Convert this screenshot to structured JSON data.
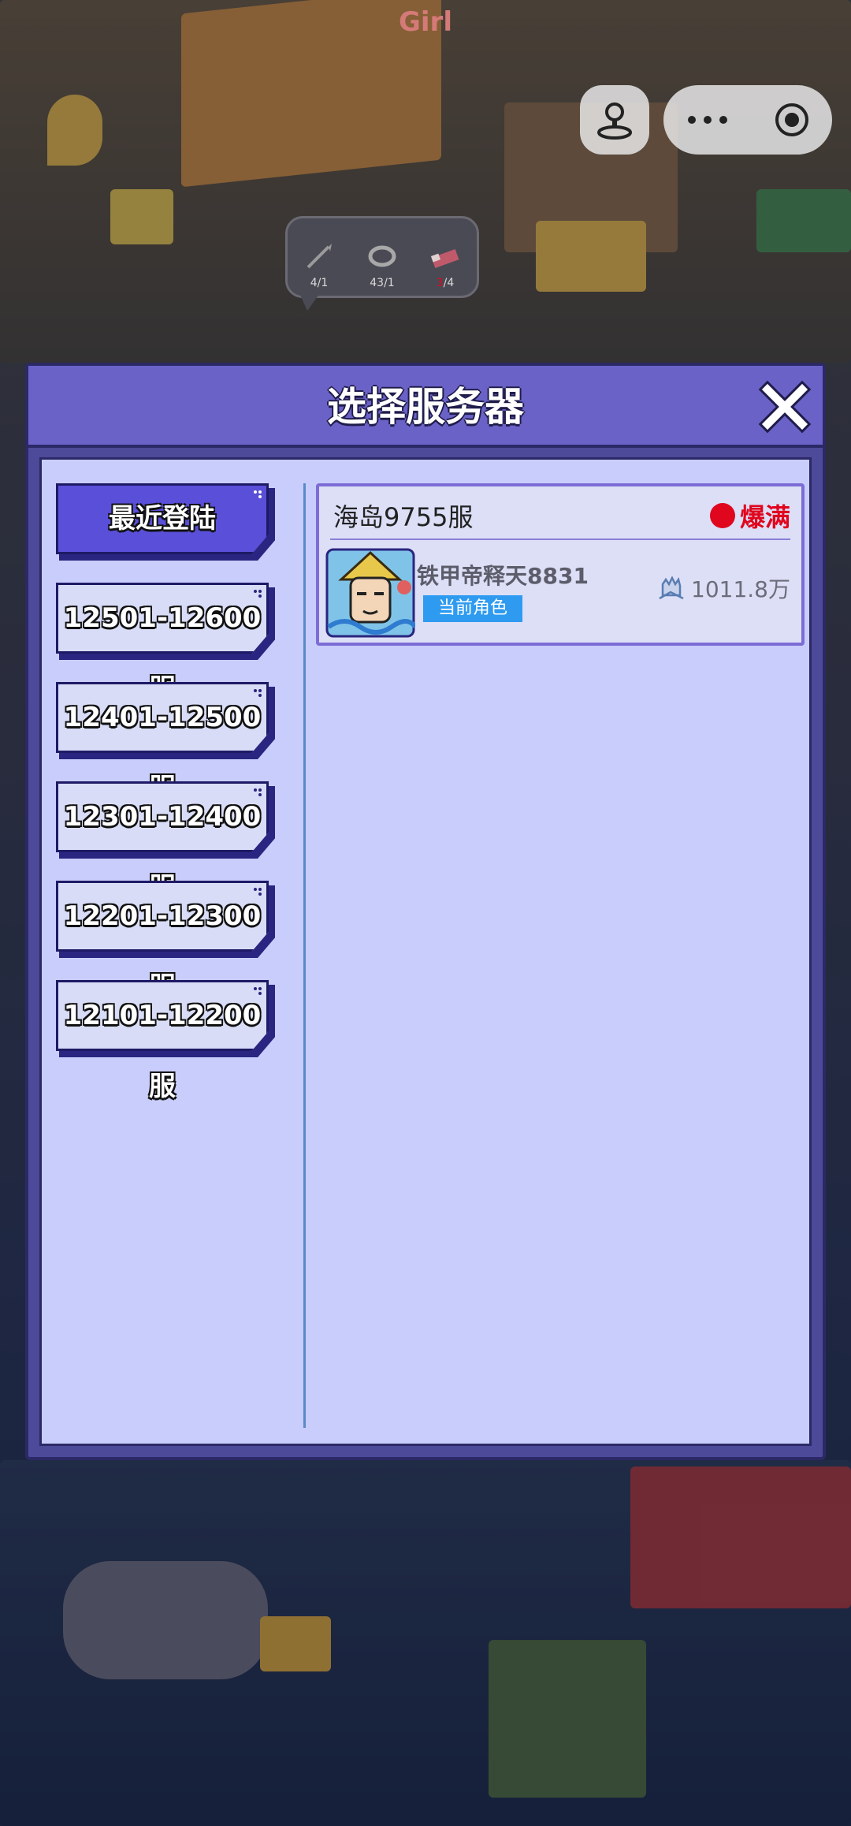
{
  "top_bar": {
    "title": "Girl"
  },
  "inventory": [
    {
      "icon": "harpoon-icon",
      "value": "4/1",
      "color": "#d9d9d9"
    },
    {
      "icon": "rope-ring-icon",
      "value": "43/1",
      "color": "#d9d9d9"
    },
    {
      "icon": "bed-icon",
      "value_main": "3",
      "value_rest": "/4",
      "color_main": "#e0061e"
    }
  ],
  "modal": {
    "title": "选择服务器",
    "categories": [
      {
        "label": "最近登陆",
        "active": true
      },
      {
        "label": "12501-12600服",
        "active": false
      },
      {
        "label": "12401-12500服",
        "active": false
      },
      {
        "label": "12301-12400服",
        "active": false
      },
      {
        "label": "12201-12300服",
        "active": false
      },
      {
        "label": "12101-12200服",
        "active": false
      }
    ],
    "server": {
      "name": "海岛9755服",
      "status": "爆满",
      "character_name": "铁甲帝释天8831",
      "current_tag": "当前角色",
      "power": "1011.8万"
    }
  },
  "colors": {
    "accent": "#6b62c8",
    "panel": "#c8cdfb",
    "status_red": "#e0061e",
    "tag_blue": "#2e9bf0"
  }
}
